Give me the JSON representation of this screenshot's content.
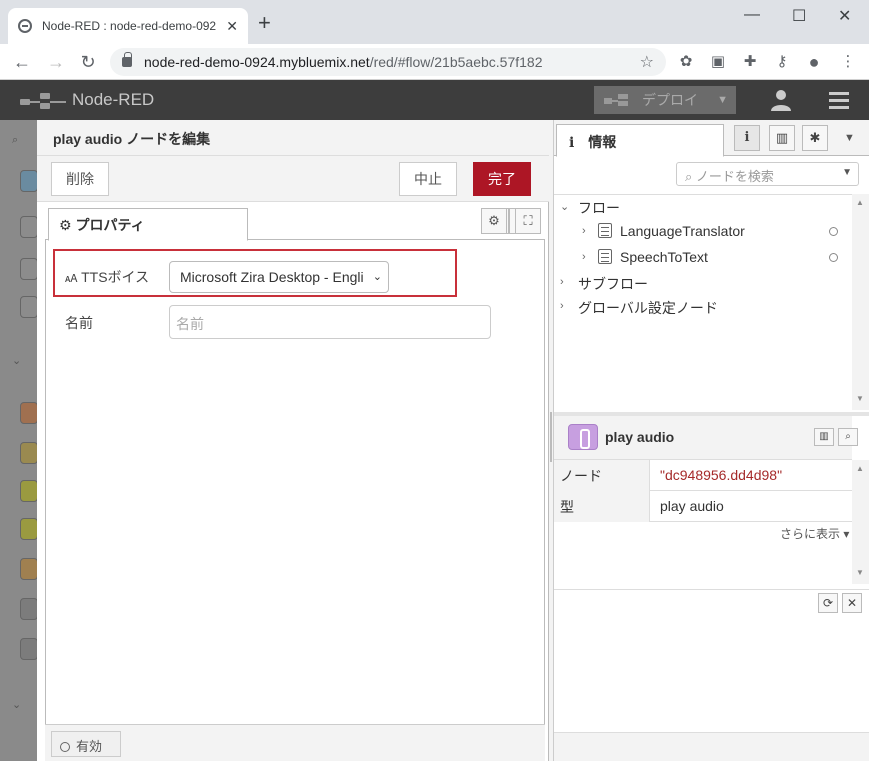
{
  "browser": {
    "tab_title": "Node-RED : node-red-demo-092",
    "tab_close": "✕",
    "new_tab": "+",
    "url_host": "node-red-demo-0924.mybluemix.net",
    "url_path": "/red/#flow/21b5aebc.57f182",
    "window_controls": [
      "—",
      "☐",
      "✕"
    ]
  },
  "header": {
    "app_title": "Node-RED",
    "deploy_label": "デプロイ"
  },
  "editor": {
    "title": "play audio ノードを編集",
    "delete_label": "削除",
    "cancel_label": "中止",
    "done_label": "完了",
    "properties_tab": "プロパティ",
    "tts_voice_label": "TTSボイス",
    "tts_voice_value": "Microsoft Zira Desktop - Engli",
    "name_label": "名前",
    "name_placeholder": "名前",
    "enabled_label": "有効"
  },
  "sidebar": {
    "info_tab": "情報",
    "search_placeholder": "ノードを検索",
    "tree": {
      "flows": "フロー",
      "flow_items": [
        "LanguageTranslator",
        "SpeechToText"
      ],
      "subflows": "サブフロー",
      "global_config": "グローバル設定ノード"
    },
    "node": {
      "name": "play audio",
      "rows": [
        {
          "key": "ノード",
          "value": "\"dc948956.dd4d98\""
        },
        {
          "key": "型",
          "value": "play audio"
        }
      ],
      "more": "さらに表示 ▾"
    }
  },
  "colors": {
    "primary": "#ad1625",
    "header_bg": "#3d3d3d",
    "highlight": "#c8303a",
    "node_purple": "#c79fe0",
    "string_value": "#a52a2a"
  }
}
